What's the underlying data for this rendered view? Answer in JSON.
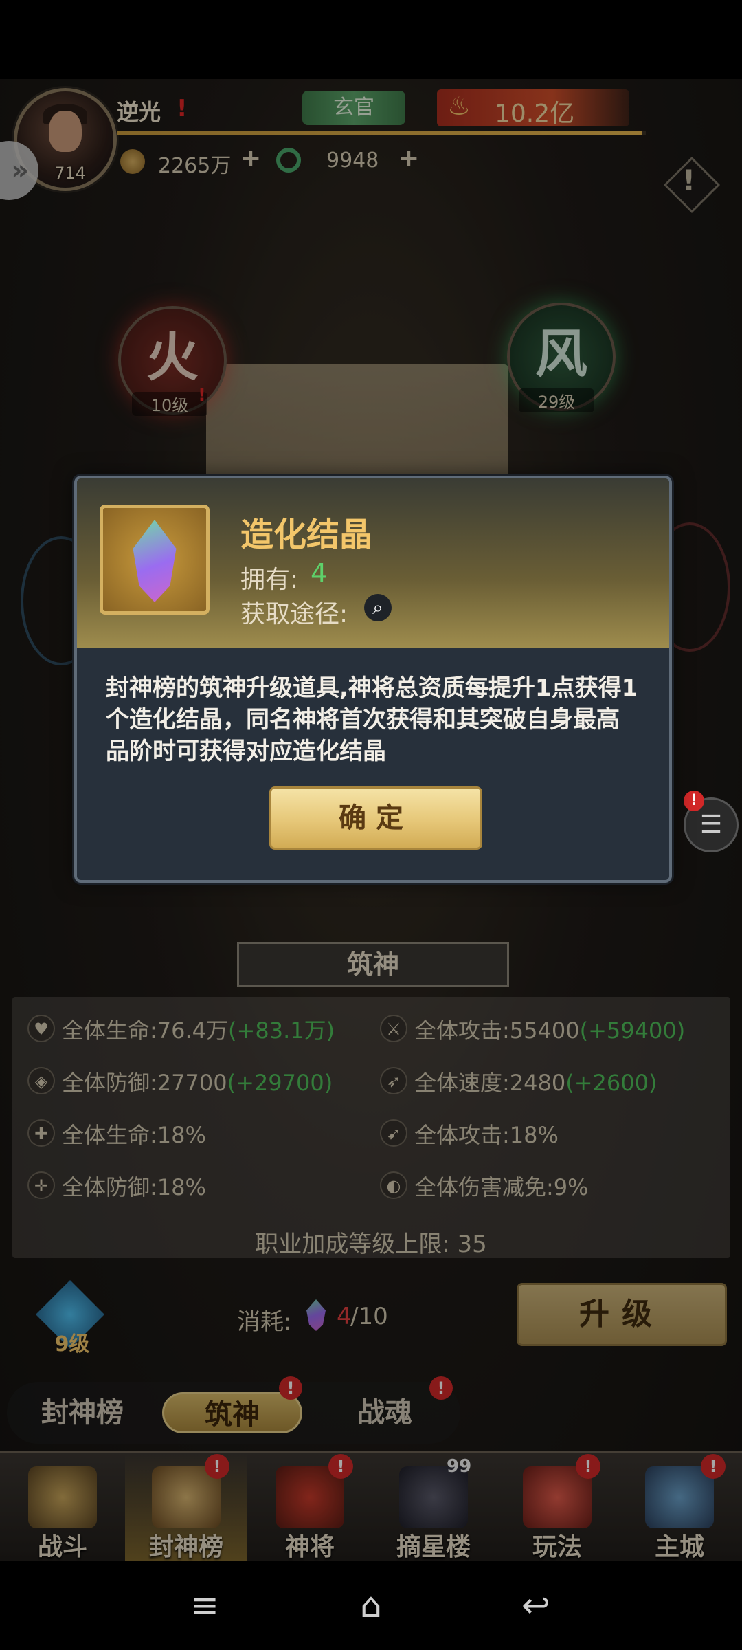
{
  "player": {
    "name": "逆光",
    "name_alert": "!",
    "power_level": "714",
    "rank": "玄官",
    "combat_power": "10.2亿"
  },
  "currency": {
    "coins": "2265万",
    "jade": "9948",
    "add": "+"
  },
  "orbs": {
    "fire": {
      "glyph": "火",
      "level": "10级",
      "alert": "!"
    },
    "wind": {
      "glyph": "风",
      "level": "29级"
    }
  },
  "modal": {
    "item_name": "造化结晶",
    "owned_label": "拥有:",
    "owned_value": "4",
    "source_label": "获取途径:",
    "description": "封神榜的筑神升级道具,神将总资质每提升1点获得1个造化结晶，同名神将首次获得和其突破自身最高品阶时可获得对应造化结晶",
    "confirm_label": "确定"
  },
  "chat": {
    "alert": "!"
  },
  "panel": {
    "title": "筑神",
    "stats": [
      {
        "icon": "heart-icon",
        "label": "全体生命:76.4万",
        "bonus": "(+83.1万)"
      },
      {
        "icon": "sword-icon",
        "label": "全体攻击:55400",
        "bonus": "(+59400)"
      },
      {
        "icon": "shield-icon",
        "label": "全体防御:27700",
        "bonus": "(+29700)"
      },
      {
        "icon": "wing-icon",
        "label": "全体速度:2480",
        "bonus": "(+2600)"
      },
      {
        "icon": "heart-plus-icon",
        "label": "全体生命:18%",
        "bonus": ""
      },
      {
        "icon": "boot-icon",
        "label": "全体攻击:18%",
        "bonus": ""
      },
      {
        "icon": "shield-plus-icon",
        "label": "全体防御:18%",
        "bonus": ""
      },
      {
        "icon": "shield-half-icon",
        "label": "全体伤害减免:9%",
        "bonus": ""
      }
    ],
    "cap_text": "职业加成等级上限: 35"
  },
  "upgrade": {
    "level": "9级",
    "cost_label": "消耗:",
    "cost_have": "4",
    "cost_need": "/10",
    "button_label": "升级"
  },
  "subtabs": [
    {
      "label": "封神榜",
      "active": false,
      "alert": ""
    },
    {
      "label": "筑神",
      "active": true,
      "alert": "!"
    },
    {
      "label": "战魂",
      "active": false,
      "alert": "!"
    }
  ],
  "bottom_nav": [
    {
      "label": "战斗",
      "badge": ""
    },
    {
      "label": "封神榜",
      "badge": "!"
    },
    {
      "label": "神将",
      "badge": "!"
    },
    {
      "label": "摘星楼",
      "badge": "99"
    },
    {
      "label": "玩法",
      "badge": "!"
    },
    {
      "label": "主城",
      "badge": "!"
    }
  ],
  "colors": {
    "accent_gold": "#f3c66a",
    "bonus_green": "#4fbf5a",
    "alert_red": "#d22828",
    "modal_bg": "#27303b"
  }
}
